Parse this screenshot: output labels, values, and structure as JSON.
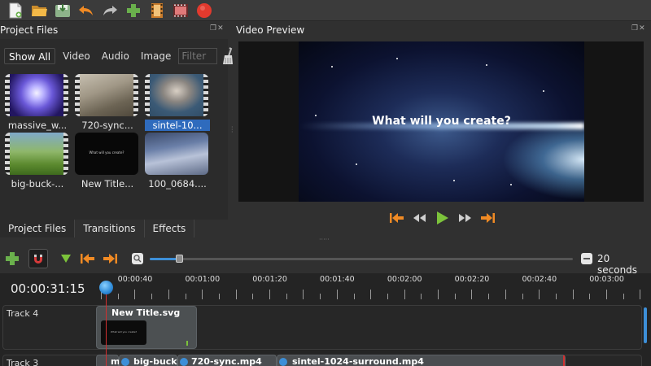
{
  "toolbar": {
    "items": [
      "new-project-icon",
      "open-project-icon",
      "save-project-icon",
      "undo-icon",
      "redo-icon",
      "import-files-icon",
      "choose-profile-icon",
      "fullscreen-icon",
      "export-video-icon"
    ]
  },
  "project_files": {
    "title": "Project Files",
    "filters": [
      "Show All",
      "Video",
      "Audio",
      "Image"
    ],
    "filter_placeholder": "Filter",
    "items": [
      {
        "label": "massive_w..."
      },
      {
        "label": "720-sync..."
      },
      {
        "label": "sintel-10..."
      },
      {
        "label": "big-buck-..."
      },
      {
        "label": "New Title..."
      },
      {
        "label": "100_0684...."
      }
    ],
    "new_title_thumb_text": "What will you create?",
    "selected_index": 2
  },
  "bottom_tabs": [
    "Project Files",
    "Transitions",
    "Effects"
  ],
  "video_preview": {
    "title": "Video Preview",
    "overlay_text": "What will you create?",
    "controls": [
      "jump-start-icon",
      "rewind-icon",
      "play-icon",
      "fast-forward-icon",
      "jump-end-icon"
    ]
  },
  "timeline_toolbar": {
    "zoom_label": "20 seconds",
    "zoom_level": 0.06
  },
  "timeline": {
    "timecode": "00:00:31:15",
    "ruler": [
      "00:00:40",
      "00:01:00",
      "00:01:20",
      "00:01:40",
      "00:02:00",
      "00:02:20",
      "00:02:40",
      "00:03:00"
    ],
    "tracks": [
      {
        "name": "Track 4",
        "clips": [
          {
            "name": "New Title.svg",
            "thumb_text": "What will you create?"
          }
        ]
      },
      {
        "name": "Track 3",
        "clips": [
          {
            "name": "m"
          },
          {
            "name": "big-buck-"
          },
          {
            "name": "720-sync.mp4"
          },
          {
            "name": "sintel-1024-surround.mp4"
          }
        ]
      }
    ]
  },
  "colors": {
    "accent": "#3d8fd8",
    "selection": "#2f6bbd",
    "record": "#e23a2e",
    "play": "#7cc33b",
    "transport": "#f08a24"
  }
}
